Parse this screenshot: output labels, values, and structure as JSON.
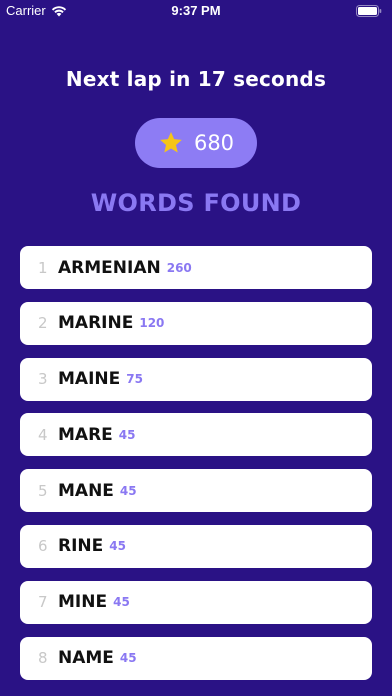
{
  "status_bar": {
    "carrier": "Carrier",
    "time": "9:37 PM",
    "wifi_icon": "wifi-icon",
    "battery_icon": "battery-icon"
  },
  "countdown": "Next lap in 17 seconds",
  "score": {
    "icon": "star-icon",
    "value": "680"
  },
  "section_title": "WORDS FOUND",
  "words": [
    {
      "rank": "1",
      "word": "ARMENIAN",
      "points": "260"
    },
    {
      "rank": "2",
      "word": "MARINE",
      "points": "120"
    },
    {
      "rank": "3",
      "word": "MAINE",
      "points": "75"
    },
    {
      "rank": "4",
      "word": "MARE",
      "points": "45"
    },
    {
      "rank": "5",
      "word": "MANE",
      "points": "45"
    },
    {
      "rank": "6",
      "word": "RINE",
      "points": "45"
    },
    {
      "rank": "7",
      "word": "MINE",
      "points": "45"
    },
    {
      "rank": "8",
      "word": "NAME",
      "points": "45"
    }
  ],
  "colors": {
    "background": "#2a1285",
    "accent": "#8a78f2",
    "pill": "#8d7cf4",
    "star": "#f5c518"
  }
}
